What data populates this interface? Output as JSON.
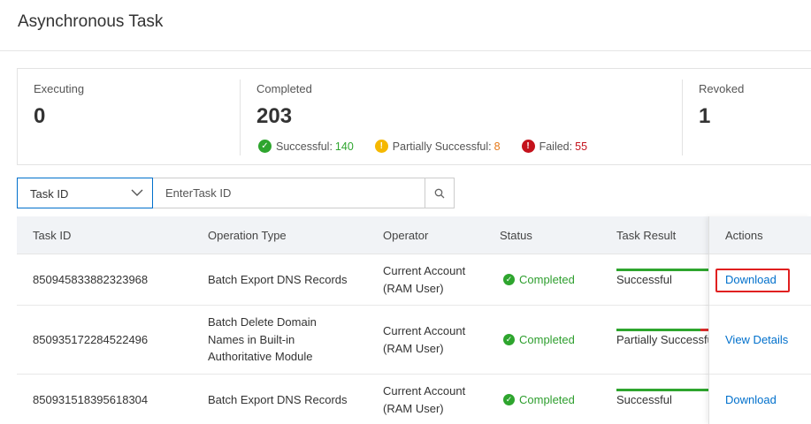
{
  "page": {
    "title": "Asynchronous Task"
  },
  "stats": {
    "executing": {
      "label": "Executing",
      "value": "0"
    },
    "completed": {
      "label": "Completed",
      "value": "203",
      "successful_label": "Successful:",
      "successful_count": "140",
      "partial_label": "Partially Successful:",
      "partial_count": "8",
      "failed_label": "Failed:",
      "failed_count": "55"
    },
    "revoked": {
      "label": "Revoked",
      "value": "1"
    }
  },
  "filter": {
    "field": "Task ID",
    "placeholder": "EnterTask ID"
  },
  "table": {
    "headers": {
      "task_id": "Task ID",
      "operation_type": "Operation Type",
      "operator": "Operator",
      "status": "Status",
      "task_result": "Task Result",
      "actions": "Actions"
    },
    "rows": [
      {
        "task_id": "850945833882323968",
        "operation_type": "Batch Export DNS Records",
        "operator_line1": "Current Account",
        "operator_line2": "(RAM User)",
        "status": "Completed",
        "result": "Successful",
        "result_success_fraction": 1.0,
        "action": "Download"
      },
      {
        "task_id": "850935172284522496",
        "operation_type_line1": "Batch Delete Domain",
        "operation_type_line2": "Names in Built-in",
        "operation_type_line3": "Authoritative Module",
        "operator_line1": "Current Account",
        "operator_line2": "(RAM User)",
        "status": "Completed",
        "result": "Partially Successful",
        "result_success_fraction": 0.9,
        "action": "View Details"
      },
      {
        "task_id": "850931518395618304",
        "operation_type": "Batch Export DNS Records",
        "operator_line1": "Current Account",
        "operator_line2": "(RAM User)",
        "status": "Completed",
        "result": "Successful",
        "result_success_fraction": 1.0,
        "action": "Download"
      }
    ]
  },
  "colors": {
    "success": "#2ea52e",
    "partial": "#f5b800",
    "failed": "#c4121c",
    "link": "#0070cc",
    "highlight": "#e02020"
  }
}
